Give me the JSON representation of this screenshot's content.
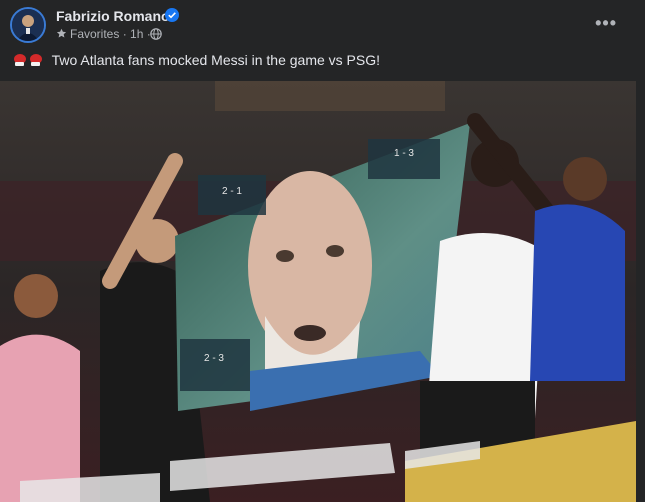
{
  "post": {
    "author": "Fabrizio Romano",
    "audience": "Favorites",
    "time": "1h",
    "separator": "·",
    "caption": "Two Atlanta fans mocked Messi in the game vs PSG!",
    "more": "•••"
  },
  "banner": {
    "score_top": "1 - 3",
    "score_left": "2 - 1",
    "score_bottom": "2 - 3"
  },
  "colors": {
    "background": "#242526",
    "text": "#e4e6eb",
    "secondary_text": "#b0b3b8",
    "verified": "#1877f2"
  }
}
